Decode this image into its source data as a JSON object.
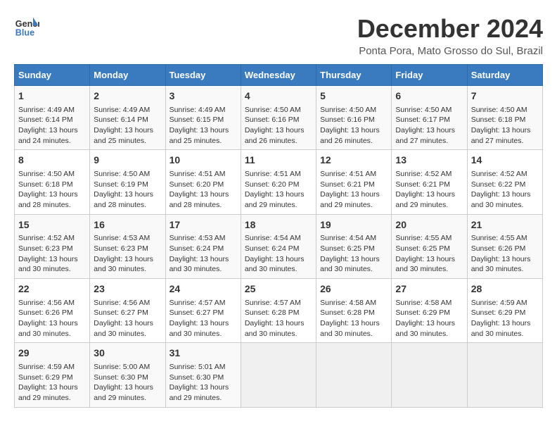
{
  "header": {
    "logo_line1": "General",
    "logo_line2": "Blue",
    "title": "December 2024",
    "subtitle": "Ponta Pora, Mato Grosso do Sul, Brazil"
  },
  "columns": [
    "Sunday",
    "Monday",
    "Tuesday",
    "Wednesday",
    "Thursday",
    "Friday",
    "Saturday"
  ],
  "weeks": [
    [
      {
        "day": "1",
        "info": "Sunrise: 4:49 AM\nSunset: 6:14 PM\nDaylight: 13 hours and 24 minutes."
      },
      {
        "day": "2",
        "info": "Sunrise: 4:49 AM\nSunset: 6:14 PM\nDaylight: 13 hours and 25 minutes."
      },
      {
        "day": "3",
        "info": "Sunrise: 4:49 AM\nSunset: 6:15 PM\nDaylight: 13 hours and 25 minutes."
      },
      {
        "day": "4",
        "info": "Sunrise: 4:50 AM\nSunset: 6:16 PM\nDaylight: 13 hours and 26 minutes."
      },
      {
        "day": "5",
        "info": "Sunrise: 4:50 AM\nSunset: 6:16 PM\nDaylight: 13 hours and 26 minutes."
      },
      {
        "day": "6",
        "info": "Sunrise: 4:50 AM\nSunset: 6:17 PM\nDaylight: 13 hours and 27 minutes."
      },
      {
        "day": "7",
        "info": "Sunrise: 4:50 AM\nSunset: 6:18 PM\nDaylight: 13 hours and 27 minutes."
      }
    ],
    [
      {
        "day": "8",
        "info": "Sunrise: 4:50 AM\nSunset: 6:18 PM\nDaylight: 13 hours and 28 minutes."
      },
      {
        "day": "9",
        "info": "Sunrise: 4:50 AM\nSunset: 6:19 PM\nDaylight: 13 hours and 28 minutes."
      },
      {
        "day": "10",
        "info": "Sunrise: 4:51 AM\nSunset: 6:20 PM\nDaylight: 13 hours and 28 minutes."
      },
      {
        "day": "11",
        "info": "Sunrise: 4:51 AM\nSunset: 6:20 PM\nDaylight: 13 hours and 29 minutes."
      },
      {
        "day": "12",
        "info": "Sunrise: 4:51 AM\nSunset: 6:21 PM\nDaylight: 13 hours and 29 minutes."
      },
      {
        "day": "13",
        "info": "Sunrise: 4:52 AM\nSunset: 6:21 PM\nDaylight: 13 hours and 29 minutes."
      },
      {
        "day": "14",
        "info": "Sunrise: 4:52 AM\nSunset: 6:22 PM\nDaylight: 13 hours and 30 minutes."
      }
    ],
    [
      {
        "day": "15",
        "info": "Sunrise: 4:52 AM\nSunset: 6:23 PM\nDaylight: 13 hours and 30 minutes."
      },
      {
        "day": "16",
        "info": "Sunrise: 4:53 AM\nSunset: 6:23 PM\nDaylight: 13 hours and 30 minutes."
      },
      {
        "day": "17",
        "info": "Sunrise: 4:53 AM\nSunset: 6:24 PM\nDaylight: 13 hours and 30 minutes."
      },
      {
        "day": "18",
        "info": "Sunrise: 4:54 AM\nSunset: 6:24 PM\nDaylight: 13 hours and 30 minutes."
      },
      {
        "day": "19",
        "info": "Sunrise: 4:54 AM\nSunset: 6:25 PM\nDaylight: 13 hours and 30 minutes."
      },
      {
        "day": "20",
        "info": "Sunrise: 4:55 AM\nSunset: 6:25 PM\nDaylight: 13 hours and 30 minutes."
      },
      {
        "day": "21",
        "info": "Sunrise: 4:55 AM\nSunset: 6:26 PM\nDaylight: 13 hours and 30 minutes."
      }
    ],
    [
      {
        "day": "22",
        "info": "Sunrise: 4:56 AM\nSunset: 6:26 PM\nDaylight: 13 hours and 30 minutes."
      },
      {
        "day": "23",
        "info": "Sunrise: 4:56 AM\nSunset: 6:27 PM\nDaylight: 13 hours and 30 minutes."
      },
      {
        "day": "24",
        "info": "Sunrise: 4:57 AM\nSunset: 6:27 PM\nDaylight: 13 hours and 30 minutes."
      },
      {
        "day": "25",
        "info": "Sunrise: 4:57 AM\nSunset: 6:28 PM\nDaylight: 13 hours and 30 minutes."
      },
      {
        "day": "26",
        "info": "Sunrise: 4:58 AM\nSunset: 6:28 PM\nDaylight: 13 hours and 30 minutes."
      },
      {
        "day": "27",
        "info": "Sunrise: 4:58 AM\nSunset: 6:29 PM\nDaylight: 13 hours and 30 minutes."
      },
      {
        "day": "28",
        "info": "Sunrise: 4:59 AM\nSunset: 6:29 PM\nDaylight: 13 hours and 30 minutes."
      }
    ],
    [
      {
        "day": "29",
        "info": "Sunrise: 4:59 AM\nSunset: 6:29 PM\nDaylight: 13 hours and 29 minutes."
      },
      {
        "day": "30",
        "info": "Sunrise: 5:00 AM\nSunset: 6:30 PM\nDaylight: 13 hours and 29 minutes."
      },
      {
        "day": "31",
        "info": "Sunrise: 5:01 AM\nSunset: 6:30 PM\nDaylight: 13 hours and 29 minutes."
      },
      {
        "day": "",
        "info": ""
      },
      {
        "day": "",
        "info": ""
      },
      {
        "day": "",
        "info": ""
      },
      {
        "day": "",
        "info": ""
      }
    ]
  ]
}
